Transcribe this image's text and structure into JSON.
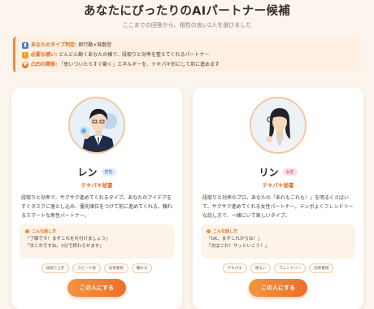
{
  "header": {
    "title": "あなたにぴったりのAIパートナー候補",
    "subtitle": "ここまでの回答から、相性の良い2人を選びました"
  },
  "summary": [
    {
      "icon": "chart-icon",
      "label": "あなたのタイプ判定:",
      "text": "即行動×発散型",
      "color": "#4a7fc0"
    },
    {
      "icon": "warning-icon",
      "label": "必要な補い:",
      "text": "どんどん動くあなたの横で、段取りと効率を整えてくれるパートナー",
      "color": "#f0a020"
    },
    {
      "icon": "heart-icon",
      "label": "凸凹の関係:",
      "text": "「思いついたらすぐ動く」エネルギーを、テキパキ形にして前に進めます",
      "color": "#e07a30"
    }
  ],
  "cards": [
    {
      "name": "レン",
      "gender": "男性",
      "role": "テキパキ秘書",
      "description": "段取りと効率で、サクサク進めてくれるタイプ。あなたのアイデアをすぐタスクに落とし込み、優先順位をつけて前に進めてくれる。頼れるスマートな男性パートナー。",
      "quote_label": "こんな話し方",
      "quotes": [
        "「了解です！まずこれを片付けましょう」",
        "「次これですね。3分で終わらせます」"
      ],
      "tags": [
        "段取り上手",
        "スピード感",
        "効率重視",
        "頼れる"
      ],
      "cta": "この人にする"
    },
    {
      "name": "リン",
      "gender": "女性",
      "role": "テキパキ秘書",
      "description": "段取りと効率のプロ。あなたの「あれもこれも！」を明るくさばいて、サクサク進めてくれる女性パートナー。テンポよくフレンドリーな話し方で、一緒にいて楽しいタイプ。",
      "quote_label": "こんな話し方",
      "quotes": [
        "「OK、まずこれからね！」",
        "「次はこれ！サッといこう！」"
      ],
      "tags": [
        "テキパキ",
        "明るい",
        "フレンドリー",
        "効率重視"
      ],
      "cta": "この人にする"
    }
  ]
}
